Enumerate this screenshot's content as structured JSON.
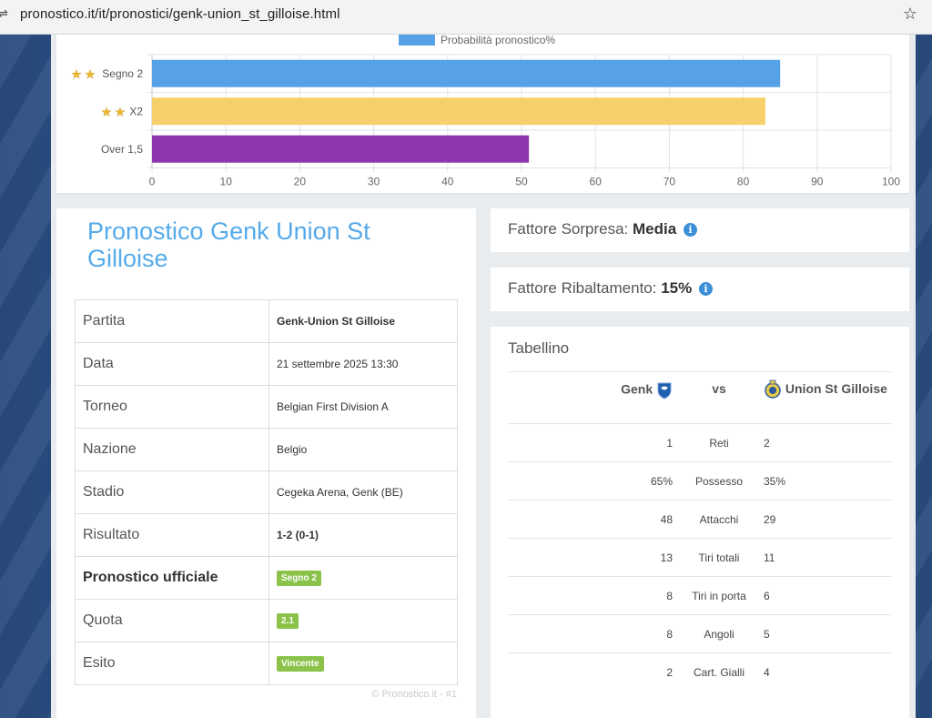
{
  "browser": {
    "url": "pronostico.it/it/pronostici/genk-union_st_gilloise.html"
  },
  "chart_data": {
    "type": "bar",
    "orientation": "horizontal",
    "legend": "Probabilità pronostico%",
    "categories": [
      "Segno 2",
      "X2",
      "Over 1,5"
    ],
    "category_stars": [
      2,
      2,
      0
    ],
    "values": [
      85,
      83,
      51
    ],
    "colors": [
      "#57a1e6",
      "#f6d06a",
      "#8e36ae"
    ],
    "xlim": [
      0,
      100
    ],
    "ticks": [
      "0",
      "10",
      "20",
      "30",
      "40",
      "50",
      "60",
      "70",
      "80",
      "90",
      "100"
    ],
    "grid": true,
    "legend_position": "top"
  },
  "match": {
    "title": "Pronostico Genk Union St Gilloise",
    "rows": [
      {
        "label": "Partita",
        "value": "Genk-Union St Gilloise"
      },
      {
        "label": "Data",
        "value": "21 settembre 2025 13:30"
      },
      {
        "label": "Torneo",
        "value": "Belgian First Division A"
      },
      {
        "label": "Nazione",
        "value": "Belgio"
      },
      {
        "label": "Stadio",
        "value": "Cegeka Arena, Genk (BE)"
      },
      {
        "label": "Risultato",
        "value": "1-2 (0-1)"
      },
      {
        "label": "Pronostico ufficiale",
        "value": "Segno 2"
      },
      {
        "label": "Quota",
        "value": "2.1"
      },
      {
        "label": "Esito",
        "value": "Vincente"
      }
    ],
    "copyright": "© Pronostico.it - #1"
  },
  "factors": {
    "surprise_label": "Fattore Sorpresa:",
    "surprise_value": "Media",
    "reversal_label": "Fattore Ribaltamento:",
    "reversal_value": "15%"
  },
  "tabellino": {
    "title": "Tabellino",
    "home": "Genk",
    "vs": "vs",
    "away": "Union St Gilloise",
    "stats": [
      {
        "home": "1",
        "label": "Reti",
        "away": "2"
      },
      {
        "home": "65%",
        "label": "Possesso",
        "away": "35%"
      },
      {
        "home": "48",
        "label": "Attacchi",
        "away": "29"
      },
      {
        "home": "13",
        "label": "Tiri totali",
        "away": "11"
      },
      {
        "home": "8",
        "label": "Tiri in porta",
        "away": "6"
      },
      {
        "home": "8",
        "label": "Angoli",
        "away": "5"
      },
      {
        "home": "2",
        "label": "Cart. Gialli",
        "away": "4"
      }
    ]
  }
}
